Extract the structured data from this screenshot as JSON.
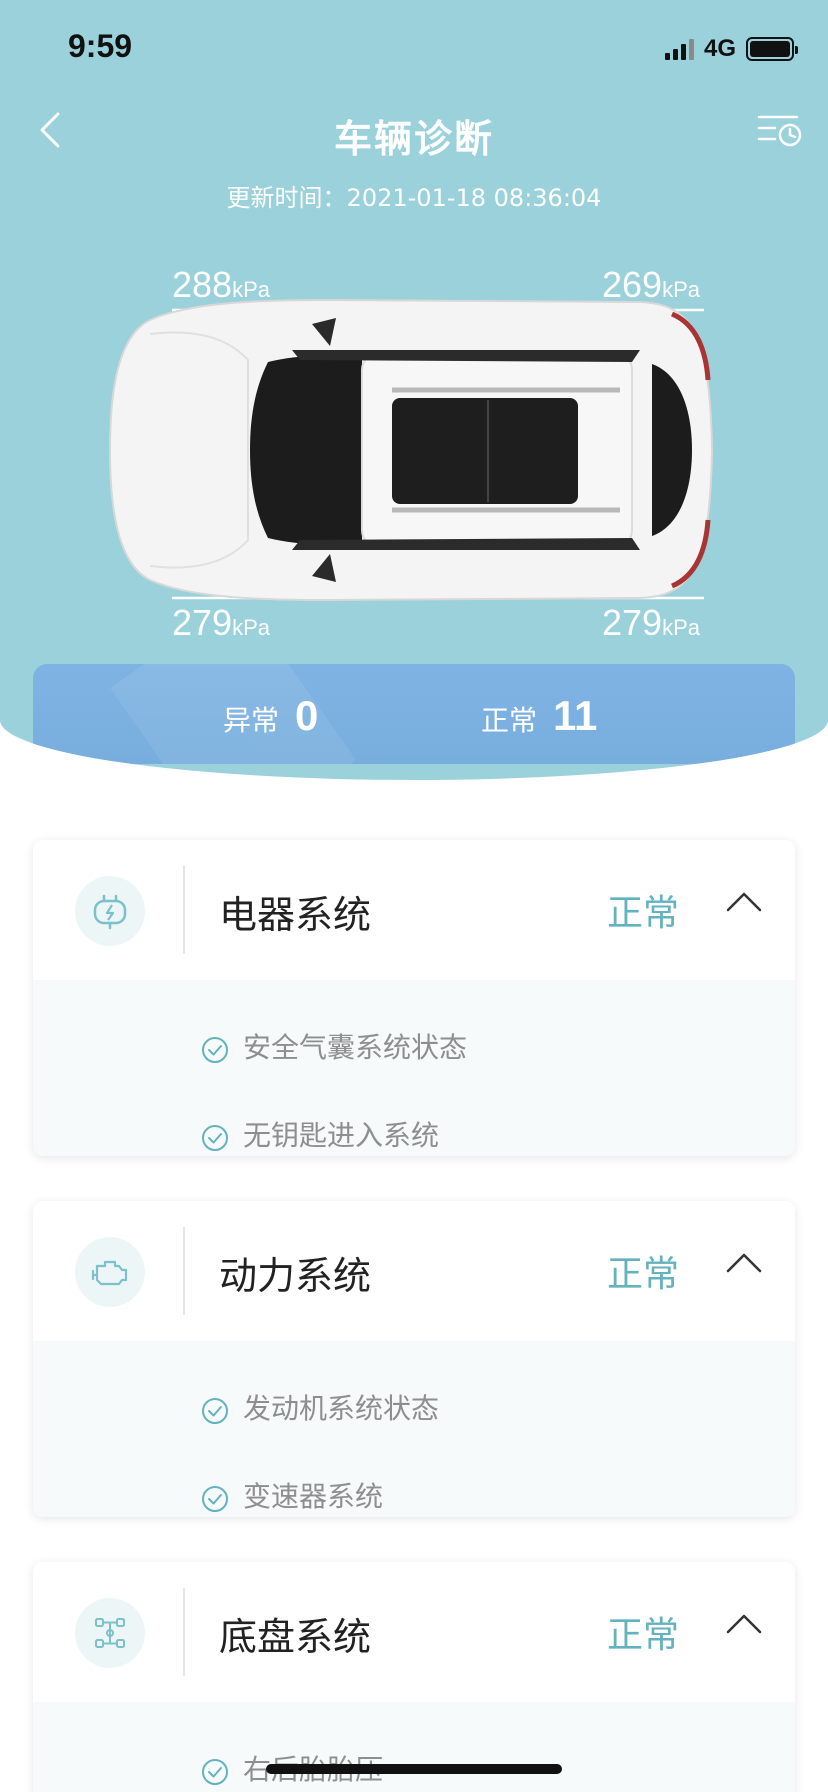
{
  "status_bar": {
    "time": "9:59",
    "network": "4G"
  },
  "nav": {
    "title": "车辆诊断",
    "back_icon": "chevron-left-icon",
    "history_icon": "history-list-icon"
  },
  "update_time": "更新时间：2021-01-18 08:36:04",
  "tire_pressure": {
    "unit": "kPa",
    "front_left": "288",
    "front_right": "269",
    "rear_left": "279",
    "rear_right": "279"
  },
  "summary": {
    "abnormal_label": "异常",
    "abnormal_count": "0",
    "normal_label": "正常",
    "normal_count": "11"
  },
  "systems": [
    {
      "name": "电器系统",
      "status": "正常",
      "icon": "battery-charge-icon",
      "items": [
        {
          "label": "安全气囊系统状态"
        },
        {
          "label": "无钥匙进入系统"
        }
      ]
    },
    {
      "name": "动力系统",
      "status": "正常",
      "icon": "engine-icon",
      "items": [
        {
          "label": "发动机系统状态"
        },
        {
          "label": "变速器系统"
        }
      ]
    },
    {
      "name": "底盘系统",
      "status": "正常",
      "icon": "chassis-icon",
      "items": [
        {
          "label": "右后胎胎压"
        }
      ]
    }
  ],
  "colors": {
    "hero_bg": "#9bd1db",
    "summary_bg": "#7fb3e3",
    "status_normal": "#63b2bd"
  }
}
